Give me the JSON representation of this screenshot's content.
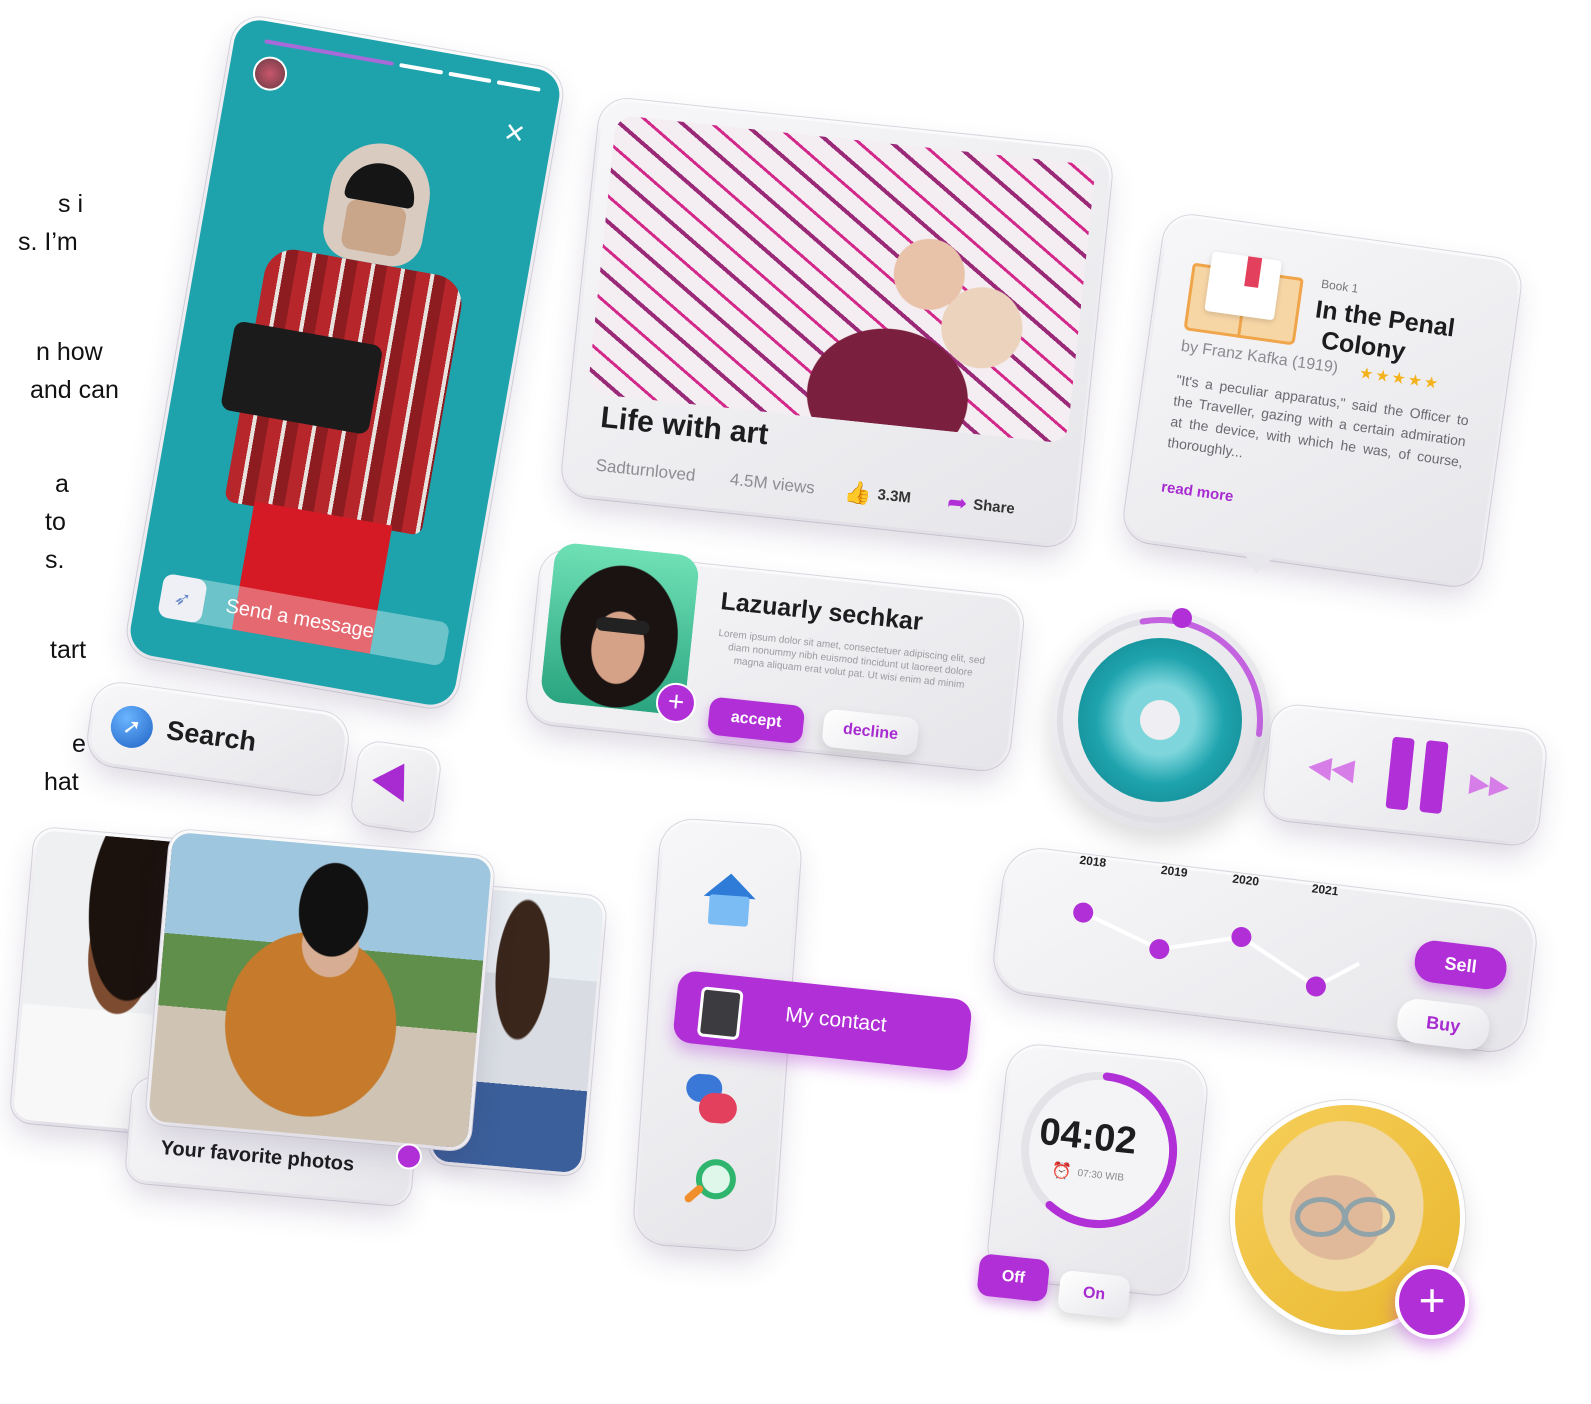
{
  "edge_text": [
    "s i",
    "s.  I’m",
    "n how",
    "and can",
    "a",
    "to",
    "s.",
    "tart",
    "e",
    "hat"
  ],
  "story": {
    "message_placeholder": "Send a message"
  },
  "video": {
    "title": "Life with art",
    "author": "Sadturnloved",
    "views": "4.5M views",
    "likes": "3.3M",
    "share_label": "Share"
  },
  "book": {
    "label": "Book 1",
    "title_line1": "In the Penal",
    "title_line2": "Colony",
    "author": "by Franz Kafka (1919)",
    "rating": 5,
    "stars": "★★★★★",
    "quote": "\"It's a peculiar apparatus,\" said the Officer to the Traveller, gazing with a certain admiration at the device, with which he was, of course, thoroughly...",
    "read_more": "read more"
  },
  "contact": {
    "name": "Lazuarly sechkar",
    "bio": "Lorem ipsum dolor sit amet, consectetuer adipiscing elit, sed diam nonummy nibh euismod tincidunt ut laoreet dolore magna aliquam erat volut pat. Ut wisi enim ad minim",
    "accept_label": "accept",
    "decline_label": "decline"
  },
  "search": {
    "label": "Search"
  },
  "player": {
    "progress": 0.3
  },
  "gallery": {
    "caption": "Your favorite photos"
  },
  "sidebar": {
    "active_label": "My contact"
  },
  "timeline": {
    "years": [
      "2018",
      "2019",
      "2020",
      "2021"
    ],
    "sell_label": "Sell",
    "buy_label": "Buy"
  },
  "timer": {
    "time": "04:02",
    "alarm": "07:30 WIB",
    "off_label": "Off",
    "on_label": "On",
    "progress": 0.6
  },
  "colors": {
    "accent": "#b12fd6",
    "teal": "#1ea3ad",
    "light": "#efeff3"
  }
}
